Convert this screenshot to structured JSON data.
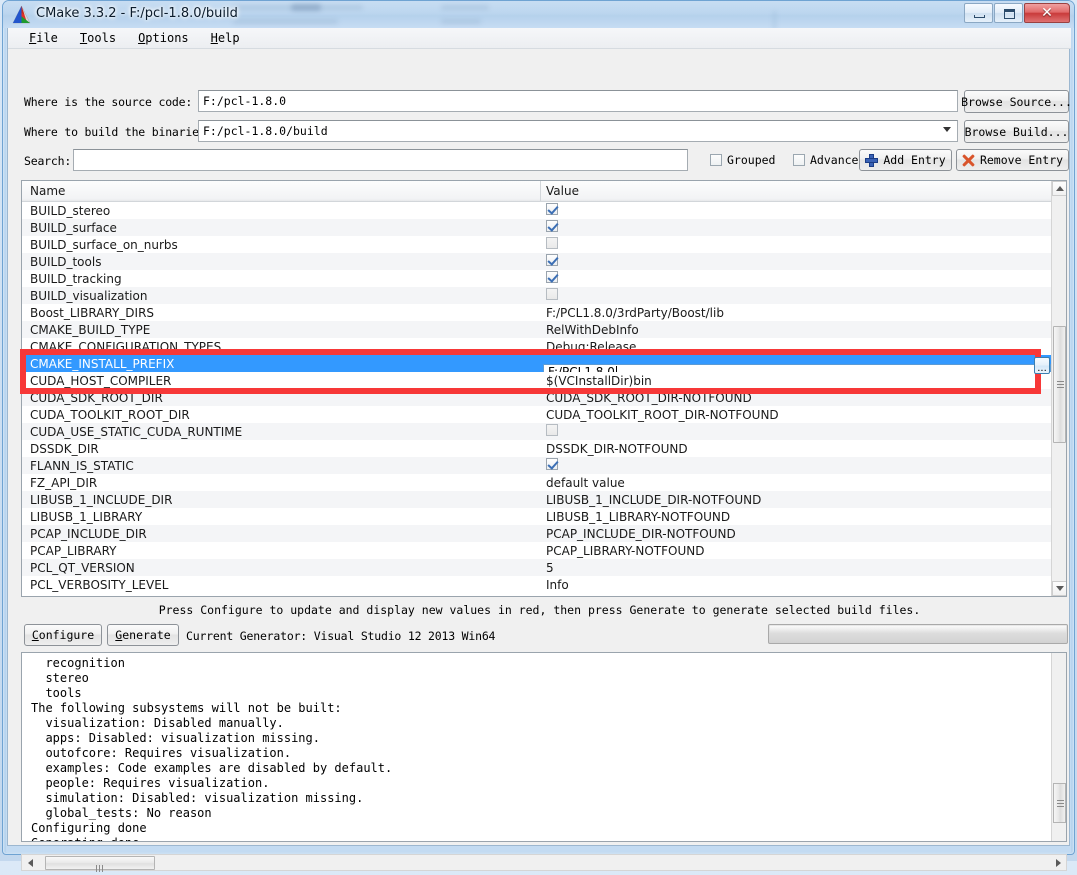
{
  "window": {
    "title": "CMake 3.3.2 - F:/pcl-1.8.0/build",
    "app_icon": "cmake-triangle-icon",
    "minimize_label": "",
    "maximize_label": "",
    "close_label": "✕"
  },
  "menu": {
    "items": [
      {
        "label": "File",
        "accel": "F"
      },
      {
        "label": "Tools",
        "accel": "T"
      },
      {
        "label": "Options",
        "accel": "O"
      },
      {
        "label": "Help",
        "accel": "H"
      }
    ]
  },
  "paths": {
    "source_label": "Where is the source code:",
    "source_value": "F:/pcl-1.8.0",
    "source_placeholder": "",
    "browse_source_label": "Browse Source...",
    "build_label": "Where to build the binaries:",
    "build_value": "F:/pcl-1.8.0/build",
    "build_placeholder": "",
    "browse_build_label": "Browse Build..."
  },
  "search": {
    "label": "Search:",
    "value": "",
    "placeholder": "",
    "grouped_label": "Grouped",
    "grouped_checked": false,
    "advanced_label": "Advanced",
    "advanced_checked": false,
    "add_entry_label": "Add Entry",
    "remove_entry_label": "Remove Entry"
  },
  "table": {
    "col_name": "Name",
    "col_value": "Value",
    "rows": [
      {
        "name": "BUILD_stereo",
        "type": "check",
        "checked": true,
        "value": ""
      },
      {
        "name": "BUILD_surface",
        "type": "check",
        "checked": true,
        "value": ""
      },
      {
        "name": "BUILD_surface_on_nurbs",
        "type": "check",
        "checked": false,
        "value": ""
      },
      {
        "name": "BUILD_tools",
        "type": "check",
        "checked": true,
        "value": ""
      },
      {
        "name": "BUILD_tracking",
        "type": "check",
        "checked": true,
        "value": ""
      },
      {
        "name": "BUILD_visualization",
        "type": "check",
        "checked": false,
        "value": ""
      },
      {
        "name": "Boost_LIBRARY_DIRS",
        "type": "text",
        "value": "F:/PCL1.8.0/3rdParty/Boost/lib"
      },
      {
        "name": "CMAKE_BUILD_TYPE",
        "type": "text",
        "value": "RelWithDebInfo"
      },
      {
        "name": "CMAKE_CONFIGURATION_TYPES",
        "type": "text",
        "value": "Debug;Release"
      },
      {
        "name": "CMAKE_INSTALL_PREFIX",
        "type": "edit",
        "value": "F:/PCL1.8.0",
        "selected": true,
        "browse_label": "..."
      },
      {
        "name": "CUDA_HOST_COMPILER",
        "type": "text",
        "value": "$(VCInstallDir)bin"
      },
      {
        "name": "CUDA_SDK_ROOT_DIR",
        "type": "text",
        "value": "CUDA_SDK_ROOT_DIR-NOTFOUND"
      },
      {
        "name": "CUDA_TOOLKIT_ROOT_DIR",
        "type": "text",
        "value": "CUDA_TOOLKIT_ROOT_DIR-NOTFOUND"
      },
      {
        "name": "CUDA_USE_STATIC_CUDA_RUNTIME",
        "type": "check",
        "checked": false,
        "value": ""
      },
      {
        "name": "DSSDK_DIR",
        "type": "text",
        "value": "DSSDK_DIR-NOTFOUND"
      },
      {
        "name": "FLANN_IS_STATIC",
        "type": "check",
        "checked": true,
        "value": ""
      },
      {
        "name": "FZ_API_DIR",
        "type": "text",
        "value": "default value"
      },
      {
        "name": "LIBUSB_1_INCLUDE_DIR",
        "type": "text",
        "value": "LIBUSB_1_INCLUDE_DIR-NOTFOUND"
      },
      {
        "name": "LIBUSB_1_LIBRARY",
        "type": "text",
        "value": "LIBUSB_1_LIBRARY-NOTFOUND"
      },
      {
        "name": "PCAP_INCLUDE_DIR",
        "type": "text",
        "value": "PCAP_INCLUDE_DIR-NOTFOUND"
      },
      {
        "name": "PCAP_LIBRARY",
        "type": "text",
        "value": "PCAP_LIBRARY-NOTFOUND"
      },
      {
        "name": "PCL_QT_VERSION",
        "type": "text",
        "value": "5"
      },
      {
        "name": "PCL_VERBOSITY_LEVEL",
        "type": "text",
        "value": "Info"
      }
    ]
  },
  "annotation": {
    "color": "#f73838",
    "target": "CMAKE_INSTALL_PREFIX"
  },
  "actions": {
    "hint": "Press Configure to update and display new values in red, then press Generate to generate selected build files.",
    "configure_label": "Configure",
    "generate_label": "Generate",
    "current_generator": "Current Generator: Visual Studio 12 2013 Win64",
    "progress_percent": 0
  },
  "log": {
    "text": "  recognition\n  stereo\n  tools\nThe following subsystems will not be built:\n  visualization: Disabled manually.\n  apps: Disabled: visualization missing.\n  outofcore: Requires visualization.\n  examples: Code examples are disabled by default.\n  people: Requires visualization.\n  simulation: Disabled: visualization missing.\n  global_tests: No reason\nConfiguring done\nGenerating done"
  },
  "colors": {
    "selection_blue": "#3399ff",
    "annotation_red": "#f73838",
    "close_red": "#c93b3b",
    "accent_plus": "#3a62b5",
    "accent_x": "#d9542b"
  }
}
